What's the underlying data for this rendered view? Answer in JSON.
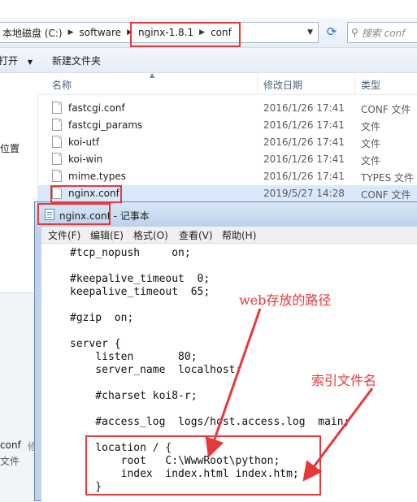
{
  "explorer": {
    "breadcrumbs": [
      "本地磁盘 (C:)",
      "software",
      "nginx-1.8.1",
      "conf"
    ],
    "search_placeholder": "搜索 conf",
    "toolbar": {
      "open_label": "打开",
      "new_folder_label": "新建文件夹"
    },
    "columns": {
      "name": "名称",
      "modified": "修改日期",
      "type": "类型"
    },
    "files": [
      {
        "name": "fastcgi.conf",
        "date": "2016/1/26 17:41",
        "type": "CONF 文件"
      },
      {
        "name": "fastcgi_params",
        "date": "2016/1/26 17:41",
        "type": "文件"
      },
      {
        "name": "koi-utf",
        "date": "2016/1/26 17:41",
        "type": "文件"
      },
      {
        "name": "koi-win",
        "date": "2016/1/26 17:41",
        "type": "文件"
      },
      {
        "name": "mime.types",
        "date": "2016/1/26 17:41",
        "type": "TYPES 文件"
      },
      {
        "name": "nginx.conf",
        "date": "2019/5/27 14:28",
        "type": "CONF 文件"
      }
    ],
    "nav_fragment": "位置",
    "details_fragment": {
      "name": "conf",
      "type": "文件",
      "tag": "修"
    }
  },
  "notepad": {
    "title_file": "nginx.conf",
    "title_app": " - 记事本",
    "menus": [
      "文件(F)",
      "编辑(E)",
      "格式(O)",
      "查看(V)",
      "帮助(H)"
    ],
    "lines": [
      "#tcp_nopush     on;",
      "",
      "#keepalive_timeout  0;",
      "keepalive_timeout  65;",
      "",
      "#gzip  on;",
      "",
      "server {",
      "    listen       80;",
      "    server_name  localhost;",
      "",
      "    #charset koi8-r;",
      "",
      "    #access_log  logs/host.access.log  main;",
      "",
      "    location / {",
      "        root   C:\\WwwRoot\\python;",
      "        index  index.html index.htm;",
      "    }"
    ]
  },
  "annotations": {
    "web_path": "web存放的路径",
    "index_name": "索引文件名",
    "color": "#e8393a"
  }
}
